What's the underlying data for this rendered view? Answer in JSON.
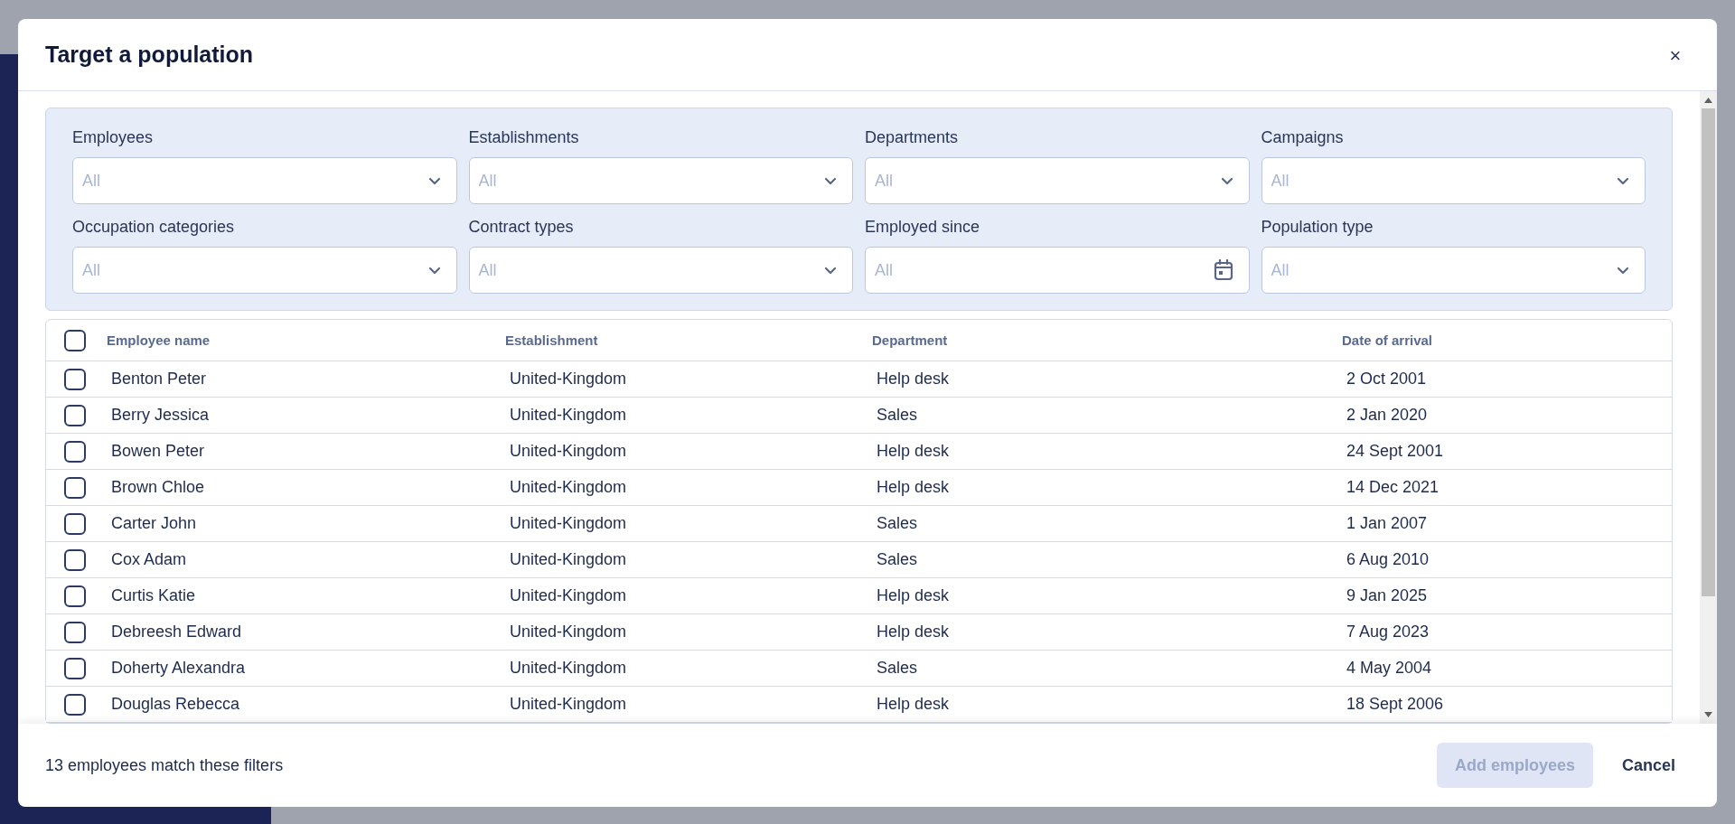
{
  "dialog": {
    "title": "Target a population",
    "close_label": "×"
  },
  "filters": [
    {
      "label": "Employees",
      "placeholder": "All",
      "kind": "select"
    },
    {
      "label": "Establishments",
      "placeholder": "All",
      "kind": "select"
    },
    {
      "label": "Departments",
      "placeholder": "All",
      "kind": "select"
    },
    {
      "label": "Campaigns",
      "placeholder": "All",
      "kind": "select"
    },
    {
      "label": "Occupation categories",
      "placeholder": "All",
      "kind": "select"
    },
    {
      "label": "Contract types",
      "placeholder": "All",
      "kind": "select"
    },
    {
      "label": "Employed since",
      "placeholder": "All",
      "kind": "date"
    },
    {
      "label": "Population type",
      "placeholder": "All",
      "kind": "select"
    }
  ],
  "table": {
    "select_all_checked": false,
    "columns": [
      "Employee name",
      "Establishment",
      "Department",
      "Date of arrival"
    ],
    "rows": [
      {
        "cells": [
          "Benton Peter",
          "United-Kingdom",
          "Help desk",
          "2 Oct 2001"
        ],
        "selected": false
      },
      {
        "cells": [
          "Berry Jessica",
          "United-Kingdom",
          "Sales",
          "2 Jan 2020"
        ],
        "selected": false
      },
      {
        "cells": [
          "Bowen Peter",
          "United-Kingdom",
          "Help desk",
          "24 Sept 2001"
        ],
        "selected": false
      },
      {
        "cells": [
          "Brown Chloe",
          "United-Kingdom",
          "Help desk",
          "14 Dec 2021"
        ],
        "selected": false
      },
      {
        "cells": [
          "Carter John",
          "United-Kingdom",
          "Sales",
          "1 Jan 2007"
        ],
        "selected": false
      },
      {
        "cells": [
          "Cox Adam",
          "United-Kingdom",
          "Sales",
          "6 Aug 2010"
        ],
        "selected": false
      },
      {
        "cells": [
          "Curtis Katie",
          "United-Kingdom",
          "Help desk",
          "9 Jan 2025"
        ],
        "selected": false
      },
      {
        "cells": [
          "Debreesh Edward",
          "United-Kingdom",
          "Help desk",
          "7 Aug 2023"
        ],
        "selected": false
      },
      {
        "cells": [
          "Doherty Alexandra",
          "United-Kingdom",
          "Sales",
          "4 May 2004"
        ],
        "selected": false
      },
      {
        "cells": [
          "Douglas Rebecca",
          "United-Kingdom",
          "Help desk",
          "18 Sept 2006"
        ],
        "selected": false
      }
    ]
  },
  "footer": {
    "summary": "13 employees match these filters",
    "buttons": [
      {
        "label": "Add employees",
        "kind": "primary",
        "disabled": true
      },
      {
        "label": "Cancel",
        "kind": "secondary",
        "disabled": false
      }
    ]
  }
}
